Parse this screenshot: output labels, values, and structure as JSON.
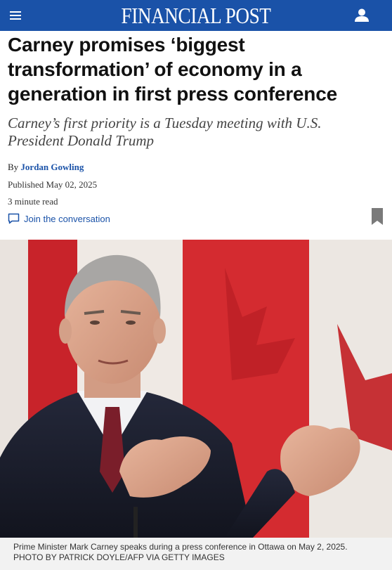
{
  "header": {
    "brand": "FINANCIAL POST",
    "menu_icon": "hamburger-menu-icon",
    "account_icon": "user-icon",
    "brand_color": "#1a52a8"
  },
  "article": {
    "headline_lines": [
      "Carney promises ‘biggest",
      "transformation’ of economy in a",
      "generation in first press conference"
    ],
    "dek_lines": [
      "Carney’s first priority is a Tuesday meeting with U.S.",
      "President Donald Trump"
    ],
    "byline_prefix": "By",
    "author": "Jordan Gowling",
    "published": "Published May 02, 2025",
    "read_time": "3 minute read",
    "join_label": "Join the conversation",
    "comment_icon": "comment-icon",
    "bookmark_icon": "bookmark-icon"
  },
  "photo": {
    "caption": "Prime Minister Mark Carney speaks during a press conference in Ottawa on May 2, 2025.",
    "credit": "PHOTO BY PATRICK DOYLE/AFP VIA GETTY IMAGES"
  }
}
